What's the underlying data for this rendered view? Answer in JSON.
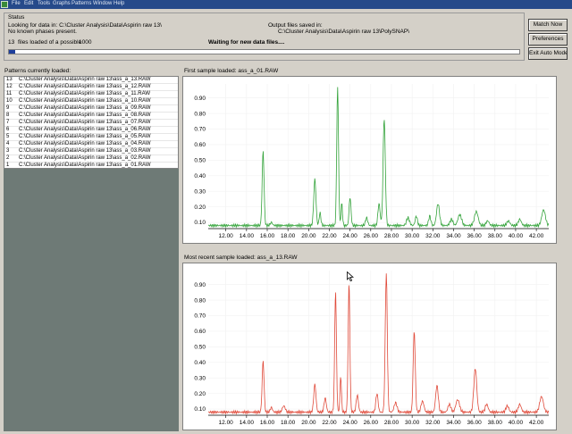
{
  "menu": [
    "File",
    "Edit",
    "Tools",
    "Graphs",
    "Patterns",
    "Window",
    "Help"
  ],
  "status": {
    "panel_title": "Status",
    "looking_label": "Looking for data in: C:\\Cluster Analysis\\Data\\Aspirin raw 13\\",
    "phases_label": "No known phases present.",
    "files_loaded": "13",
    "files_loaded_label": "files loaded of a possible",
    "files_possible": "1000",
    "waiting_label": "Waiting for new data files....",
    "output_label": "Output files saved in:",
    "output_path": "C:\\Cluster Analysis\\Data\\Aspirin raw 13\\PolySNAP\\",
    "progress": 0.013
  },
  "buttons": {
    "match_now": "Match Now",
    "preferences": "Preferences",
    "exit_auto": "Exit Auto Mode"
  },
  "patterns": {
    "title": "Patterns currently loaded:",
    "rows": [
      {
        "n": "13",
        "path": "C:\\Cluster Analysis\\Data\\Aspirin raw 13\\ass_a_13.RAW"
      },
      {
        "n": "12",
        "path": "C:\\Cluster Analysis\\Data\\Aspirin raw 13\\ass_a_12.RAW"
      },
      {
        "n": "11",
        "path": "C:\\Cluster Analysis\\Data\\Aspirin raw 13\\ass_a_11.RAW"
      },
      {
        "n": "10",
        "path": "C:\\Cluster Analysis\\Data\\Aspirin raw 13\\ass_a_10.RAW"
      },
      {
        "n": "9",
        "path": "C:\\Cluster Analysis\\Data\\Aspirin raw 13\\ass_a_09.RAW"
      },
      {
        "n": "8",
        "path": "C:\\Cluster Analysis\\Data\\Aspirin raw 13\\ass_a_08.RAW"
      },
      {
        "n": "7",
        "path": "C:\\Cluster Analysis\\Data\\Aspirin raw 13\\ass_a_07.RAW"
      },
      {
        "n": "6",
        "path": "C:\\Cluster Analysis\\Data\\Aspirin raw 13\\ass_a_06.RAW"
      },
      {
        "n": "5",
        "path": "C:\\Cluster Analysis\\Data\\Aspirin raw 13\\ass_a_05.RAW"
      },
      {
        "n": "4",
        "path": "C:\\Cluster Analysis\\Data\\Aspirin raw 13\\ass_a_04.RAW"
      },
      {
        "n": "3",
        "path": "C:\\Cluster Analysis\\Data\\Aspirin raw 13\\ass_a_03.RAW"
      },
      {
        "n": "2",
        "path": "C:\\Cluster Analysis\\Data\\Aspirin raw 13\\ass_a_02.RAW"
      },
      {
        "n": "1",
        "path": "C:\\Cluster Analysis\\Data\\Aspirin raw 13\\ass_a_01.RAW"
      }
    ]
  },
  "charts": {
    "first_title": "First sample loaded:  ass_a_01.RAW",
    "recent_title": "Most recent sample loaded:  ass_a_13.RAW"
  },
  "chart_data": [
    {
      "type": "line",
      "color": "#33a33a",
      "xlim": [
        10.3,
        43.2
      ],
      "ylim": [
        0.06,
        0.99
      ],
      "xticks": [
        "12.00",
        "14.00",
        "16.00",
        "18.00",
        "20.00",
        "22.00",
        "24.00",
        "26.00",
        "28.00",
        "30.00",
        "32.00",
        "34.00",
        "36.00",
        "38.00",
        "40.00",
        "42.00"
      ],
      "xtick_values": [
        12,
        14,
        16,
        18,
        20,
        22,
        24,
        26,
        28,
        30,
        32,
        34,
        36,
        38,
        40,
        42
      ],
      "yticks": [
        "0.10",
        "0.20",
        "0.30",
        "0.40",
        "0.50",
        "0.60",
        "0.70",
        "0.80",
        "0.90"
      ],
      "ytick_values": [
        0.1,
        0.2,
        0.3,
        0.4,
        0.5,
        0.6,
        0.7,
        0.8,
        0.9
      ],
      "baseline": 0.08,
      "peaks": [
        {
          "x": 15.6,
          "h": 0.56,
          "w": 0.13
        },
        {
          "x": 16.4,
          "h": 0.1,
          "w": 0.15
        },
        {
          "x": 20.6,
          "h": 0.38,
          "w": 0.15
        },
        {
          "x": 21.1,
          "h": 0.16,
          "w": 0.12
        },
        {
          "x": 22.8,
          "h": 0.97,
          "w": 0.12
        },
        {
          "x": 23.2,
          "h": 0.22,
          "w": 0.1
        },
        {
          "x": 24.0,
          "h": 0.26,
          "w": 0.13
        },
        {
          "x": 25.6,
          "h": 0.13,
          "w": 0.15
        },
        {
          "x": 26.8,
          "h": 0.22,
          "w": 0.15
        },
        {
          "x": 27.3,
          "h": 0.77,
          "w": 0.15
        },
        {
          "x": 29.6,
          "h": 0.13,
          "w": 0.2
        },
        {
          "x": 30.4,
          "h": 0.14,
          "w": 0.15
        },
        {
          "x": 31.7,
          "h": 0.14,
          "w": 0.15
        },
        {
          "x": 32.5,
          "h": 0.22,
          "w": 0.2
        },
        {
          "x": 33.8,
          "h": 0.12,
          "w": 0.2
        },
        {
          "x": 34.6,
          "h": 0.15,
          "w": 0.25
        },
        {
          "x": 36.2,
          "h": 0.17,
          "w": 0.25
        },
        {
          "x": 37.3,
          "h": 0.11,
          "w": 0.2
        },
        {
          "x": 39.3,
          "h": 0.11,
          "w": 0.2
        },
        {
          "x": 40.4,
          "h": 0.12,
          "w": 0.2
        },
        {
          "x": 42.7,
          "h": 0.18,
          "w": 0.25
        }
      ]
    },
    {
      "type": "line",
      "color": "#e04a3a",
      "xlim": [
        10.3,
        43.2
      ],
      "ylim": [
        0.06,
        0.99
      ],
      "xticks": [
        "12.00",
        "14.00",
        "16.00",
        "18.00",
        "20.00",
        "22.00",
        "24.00",
        "26.00",
        "28.00",
        "30.00",
        "32.00",
        "34.00",
        "36.00",
        "38.00",
        "40.00",
        "42.00"
      ],
      "xtick_values": [
        12,
        14,
        16,
        18,
        20,
        22,
        24,
        26,
        28,
        30,
        32,
        34,
        36,
        38,
        40,
        42
      ],
      "yticks": [
        "0.10",
        "0.20",
        "0.30",
        "0.40",
        "0.50",
        "0.60",
        "0.70",
        "0.80",
        "0.90"
      ],
      "ytick_values": [
        0.1,
        0.2,
        0.3,
        0.4,
        0.5,
        0.6,
        0.7,
        0.8,
        0.9
      ],
      "baseline": 0.08,
      "peaks": [
        {
          "x": 15.6,
          "h": 0.41,
          "w": 0.13
        },
        {
          "x": 16.4,
          "h": 0.11,
          "w": 0.15
        },
        {
          "x": 17.6,
          "h": 0.12,
          "w": 0.2
        },
        {
          "x": 20.6,
          "h": 0.26,
          "w": 0.15
        },
        {
          "x": 21.6,
          "h": 0.17,
          "w": 0.15
        },
        {
          "x": 22.6,
          "h": 0.86,
          "w": 0.12
        },
        {
          "x": 23.1,
          "h": 0.31,
          "w": 0.1
        },
        {
          "x": 23.9,
          "h": 0.91,
          "w": 0.12
        },
        {
          "x": 24.7,
          "h": 0.19,
          "w": 0.15
        },
        {
          "x": 26.6,
          "h": 0.2,
          "w": 0.15
        },
        {
          "x": 27.5,
          "h": 0.97,
          "w": 0.14
        },
        {
          "x": 28.4,
          "h": 0.14,
          "w": 0.2
        },
        {
          "x": 30.2,
          "h": 0.6,
          "w": 0.14
        },
        {
          "x": 31.0,
          "h": 0.15,
          "w": 0.2
        },
        {
          "x": 32.4,
          "h": 0.25,
          "w": 0.18
        },
        {
          "x": 33.6,
          "h": 0.13,
          "w": 0.2
        },
        {
          "x": 34.4,
          "h": 0.16,
          "w": 0.25
        },
        {
          "x": 36.1,
          "h": 0.36,
          "w": 0.2
        },
        {
          "x": 37.2,
          "h": 0.13,
          "w": 0.2
        },
        {
          "x": 39.2,
          "h": 0.12,
          "w": 0.2
        },
        {
          "x": 40.4,
          "h": 0.13,
          "w": 0.2
        },
        {
          "x": 42.5,
          "h": 0.18,
          "w": 0.25
        }
      ]
    }
  ]
}
